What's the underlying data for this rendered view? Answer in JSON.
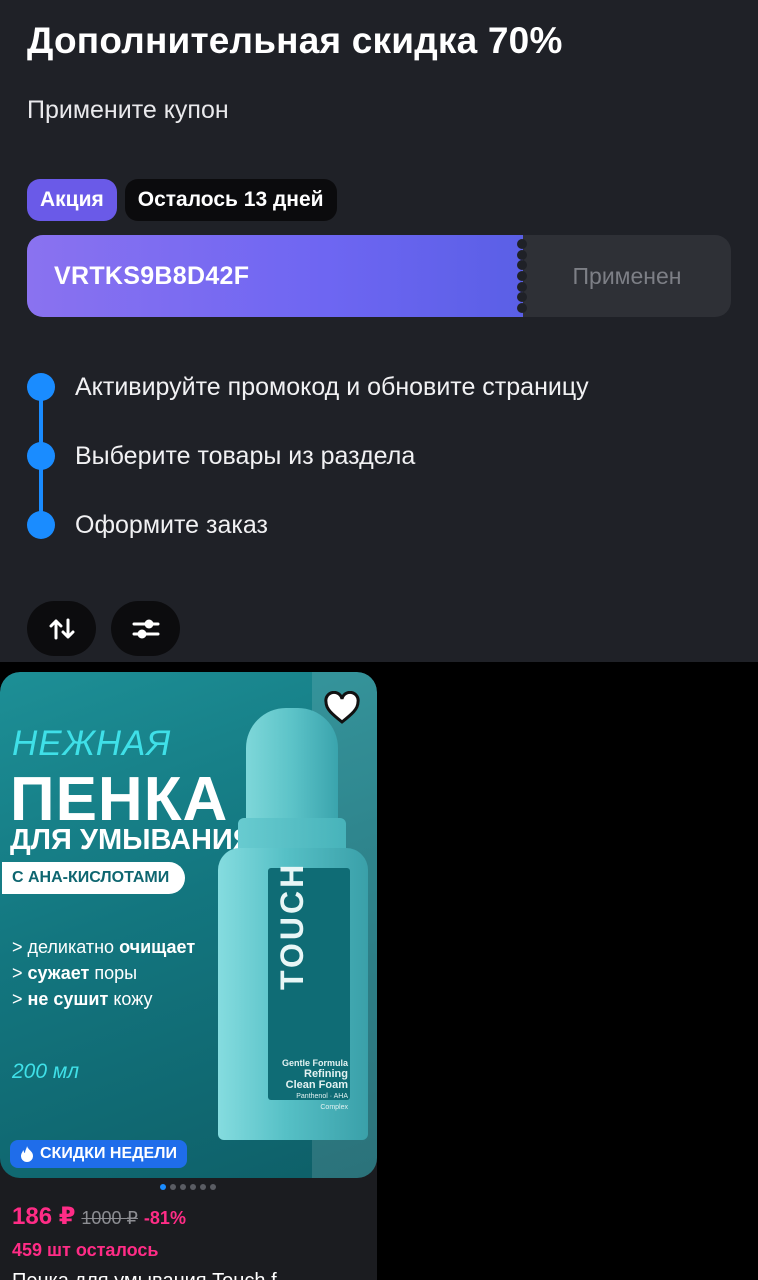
{
  "promo": {
    "title": "Дополнительная скидка 70%",
    "subtitle": "Примените купон",
    "badge_promo": "Акция",
    "badge_days": "Осталось 13 дней",
    "coupon_code": "VRTKS9B8D42F",
    "coupon_status": "Применен",
    "steps": [
      {
        "text": "Активируйте промокод и обновите страницу"
      },
      {
        "text": "Выберите товары из раздела"
      },
      {
        "text": "Оформите заказ"
      }
    ]
  },
  "toolbar": {
    "sort_icon": "sort-arrows-icon",
    "filter_icon": "filter-sliders-icon"
  },
  "product": {
    "image_text": {
      "line1": "НЕЖНАЯ",
      "line2": "ПЕНКА",
      "line3": "ДЛЯ УМЫВАНИЯ",
      "pill": "С АНА-КИСЛОТАМИ",
      "bullet1_a": "> деликатно ",
      "bullet1_b": "очищает",
      "bullet2_a": "> ",
      "bullet2_b": "сужает",
      "bullet2_c": " поры",
      "bullet3_a": "> ",
      "bullet3_b": "не сушит",
      "bullet3_c": " кожу",
      "volume": "200 мл",
      "brand": "TOUCH",
      "fine1": "Gentle Formula",
      "fine2": "Refining",
      "fine3": "Clean Foam",
      "fine4": "Panthenol · AHA Complex"
    },
    "sale_badge": "СКИДКИ НЕДЕЛИ",
    "price_now": "186 ₽",
    "price_old": "1000 ₽",
    "discount": "-81%",
    "stock_left": "459 шт осталось",
    "name_partial": "Пенка для умывания Touch f",
    "gallery_count": 6,
    "gallery_active": 1,
    "colors": {
      "accent": "#1a8cff",
      "price": "#ff2c86",
      "promo": "#6a5ae8"
    }
  }
}
